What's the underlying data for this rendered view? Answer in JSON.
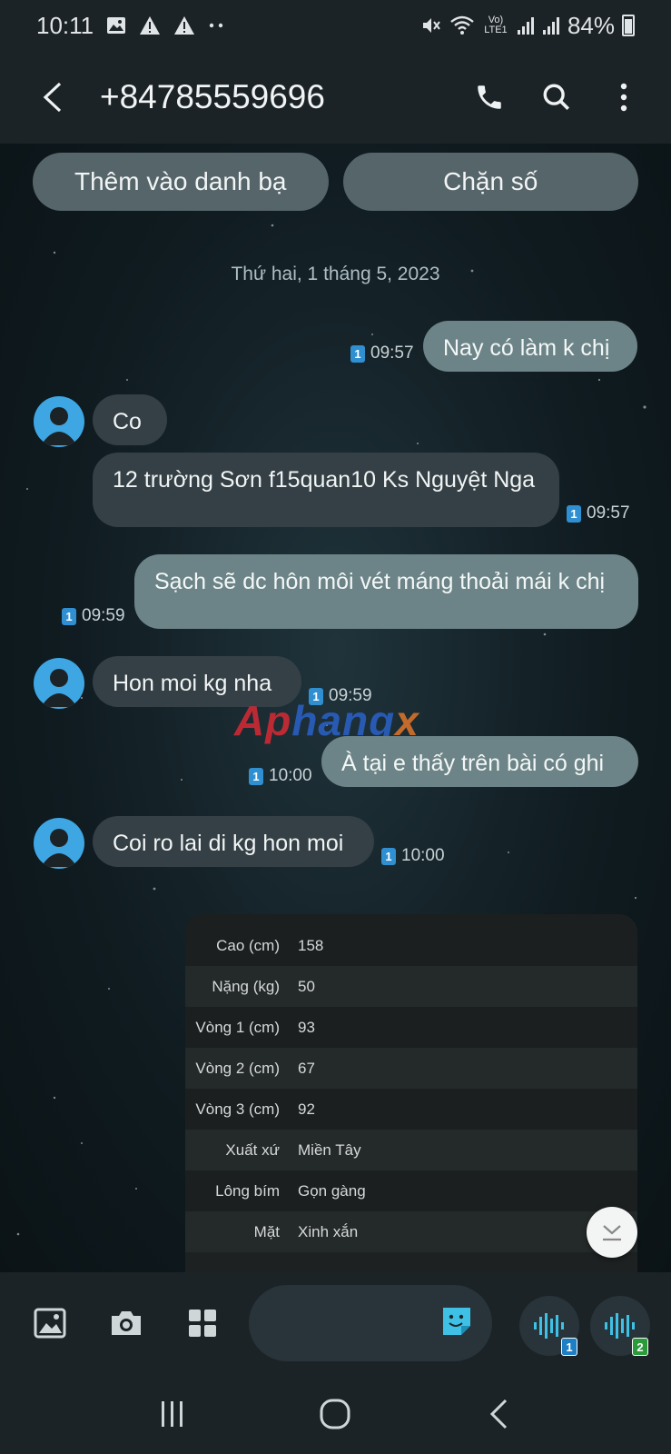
{
  "status_bar": {
    "time": "10:11",
    "battery": "84%",
    "network": "Vo) LTE1",
    "icons": [
      "image-icon",
      "alert-icon",
      "alert-icon",
      "more-dots-icon",
      "mute-icon",
      "wifi-icon",
      "signal-icon",
      "signal-icon",
      "battery-icon"
    ]
  },
  "header": {
    "title": "+84785559696",
    "icons": [
      "back-icon",
      "phone-icon",
      "search-icon",
      "more-vert-icon"
    ]
  },
  "actions": {
    "add_contact": "Thêm vào danh bạ",
    "block_number": "Chặn số"
  },
  "date_separator": "Thứ hai, 1 tháng 5, 2023",
  "messages": [
    {
      "direction": "out",
      "text": "Nay có làm k chị",
      "time": "09:57",
      "sim": "1"
    },
    {
      "direction": "in",
      "text": "Co",
      "time": "",
      "sim": ""
    },
    {
      "direction": "in",
      "text": "12 trường Sơn f15quan10 Ks Nguyệt Nga",
      "time": "09:57",
      "sim": "1"
    },
    {
      "direction": "out",
      "text": "Sạch sẽ dc hôn môi vét máng thoải mái k chị",
      "time": "09:59",
      "sim": "1"
    },
    {
      "direction": "in",
      "text": "Hon moi kg nha",
      "time": "09:59",
      "sim": "1"
    },
    {
      "direction": "out",
      "text": "À tại e thấy trên bài có ghi",
      "time": "10:00",
      "sim": "1"
    },
    {
      "direction": "in",
      "text": "Coi ro lai di kg hon moi",
      "time": "10:00",
      "sim": "1"
    }
  ],
  "watermark": {
    "part1": "Ap",
    "part2": "hang",
    "part3": "x"
  },
  "profile_table": [
    {
      "key": "Cao (cm)",
      "value": "158"
    },
    {
      "key": "Nặng (kg)",
      "value": "50"
    },
    {
      "key": "Vòng 1 (cm)",
      "value": "93"
    },
    {
      "key": "Vòng 2 (cm)",
      "value": "67"
    },
    {
      "key": "Vòng 3 (cm)",
      "value": "92"
    },
    {
      "key": "Xuất xứ",
      "value": "Miền Tây"
    },
    {
      "key": "Lông bím",
      "value": "Gọn gàng"
    },
    {
      "key": "Mặt",
      "value": "Xinh xắn"
    }
  ],
  "composer": {
    "tools": [
      "gallery-icon",
      "camera-icon",
      "apps-grid-icon"
    ],
    "sticker_icon": "sticker-icon",
    "voice_buttons": [
      {
        "badge": "1",
        "badge_color": "#1f7fc4"
      },
      {
        "badge": "2",
        "badge_color": "#2a9a3a"
      }
    ]
  },
  "nav_bar": {
    "icons": [
      "recents-icon",
      "home-icon",
      "nav-back-icon"
    ]
  },
  "colors": {
    "accent": "#3ea6e3",
    "incoming_bubble": "#344045",
    "outgoing_bubble": "#6c8487",
    "pill": "#56656a"
  }
}
